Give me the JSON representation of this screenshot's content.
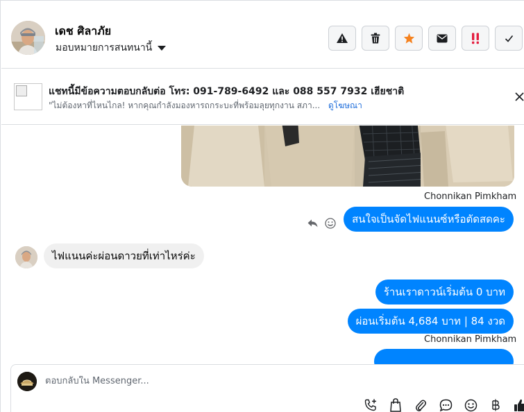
{
  "header": {
    "contact_name": "เดช ศิลาภัย",
    "assign_label": "มอบหมายการสนทนานี้"
  },
  "actions": [
    {
      "name": "spam-warning-button",
      "icon": "warning-icon"
    },
    {
      "name": "delete-button",
      "icon": "trash-icon"
    },
    {
      "name": "star-button",
      "icon": "star-icon"
    },
    {
      "name": "mark-unread-button",
      "icon": "envelope-icon"
    },
    {
      "name": "mark-important-button",
      "icon": "double-exclamation-icon"
    },
    {
      "name": "mark-done-button",
      "icon": "check-icon"
    }
  ],
  "ad": {
    "title": "แชทนี้มีข้อความตอบกลับต่อ โทร: 091-789-6492 และ 088 557 7932 เฮียชาติ",
    "description": "\"ไม่ต้องหาที่ไหนไกล! หากคุณกำลังมองหารถกระบะที่พร้อมลุยทุกงาน สภา...",
    "link": "ดูโฆษณา"
  },
  "messages": {
    "sender_name": "Chonnikan Pimkham",
    "out_1": "สนใจเป็นจัดไฟแนนซ์หรือตัดสดคะ",
    "in_1": "ไฟแนนค่ะผ่อนดาวยที่เท่าไหร่ค่ะ",
    "out_2": "ร้านเราดาวน์เริ่มต้น 0 บาท",
    "out_3": "ผ่อนเริ่มต้น 4,684 บาท | 84 งวด",
    "sender_name_2": "Chonnikan Pimkham"
  },
  "composer": {
    "placeholder": "ตอบกลับใน Messenger..."
  },
  "colors": {
    "accent": "#0084ff",
    "star": "#f5821f",
    "important": "#e41e3f"
  }
}
